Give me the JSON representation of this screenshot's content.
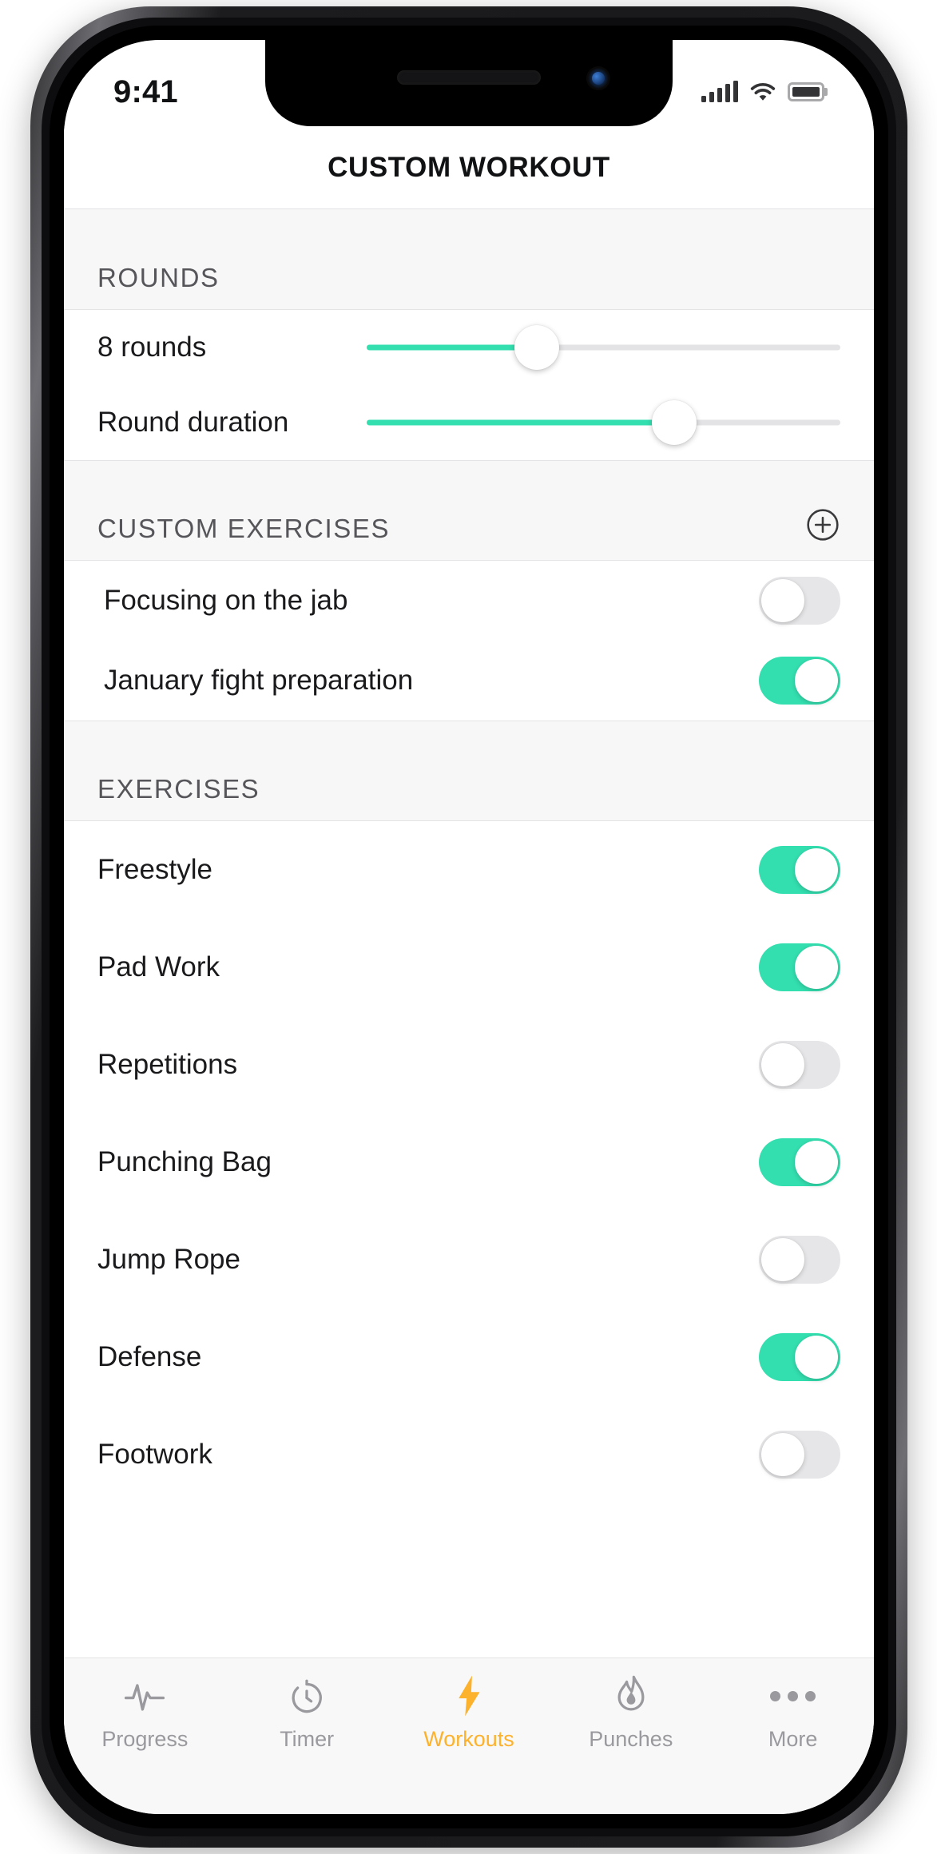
{
  "status_bar": {
    "time": "9:41",
    "signal_icon": "cellular-signal-icon",
    "signal_bars_filled": 5,
    "wifi_icon": "wifi-icon",
    "battery_icon": "battery-full-icon",
    "battery_level": 100
  },
  "navbar": {
    "title": "CUSTOM WORKOUT"
  },
  "colors": {
    "accent_green": "#33dfaf",
    "accent_orange": "#fcb22c",
    "track_grey": "#e3e3e5",
    "section_bg": "#f7f7f8"
  },
  "sections": {
    "rounds": {
      "header": "ROUNDS",
      "sliders": [
        {
          "label": "8 rounds",
          "value_percent": 36,
          "name": "rounds-slider"
        },
        {
          "label": "Round duration",
          "value_percent": 65,
          "name": "round-duration-slider"
        }
      ]
    },
    "custom_exercises": {
      "header": "CUSTOM EXERCISES",
      "add_icon": "plus-circle-icon",
      "items": [
        {
          "label": "Focusing on the jab",
          "enabled": false
        },
        {
          "label": "January fight preparation",
          "enabled": true
        }
      ]
    },
    "exercises": {
      "header": "EXERCISES",
      "items": [
        {
          "label": "Freestyle",
          "enabled": true
        },
        {
          "label": "Pad Work",
          "enabled": true
        },
        {
          "label": "Repetitions",
          "enabled": false
        },
        {
          "label": "Punching Bag",
          "enabled": true
        },
        {
          "label": "Jump Rope",
          "enabled": false
        },
        {
          "label": "Defense",
          "enabled": true
        },
        {
          "label": "Footwork",
          "enabled": false
        }
      ]
    }
  },
  "tabbar": {
    "tabs": [
      {
        "label": "Progress",
        "icon": "pulse-icon",
        "active": false
      },
      {
        "label": "Timer",
        "icon": "stopwatch-icon",
        "active": false
      },
      {
        "label": "Workouts",
        "icon": "bolt-icon",
        "active": true
      },
      {
        "label": "Punches",
        "icon": "flame-icon",
        "active": false
      },
      {
        "label": "More",
        "icon": "ellipsis-icon",
        "active": false
      }
    ]
  }
}
